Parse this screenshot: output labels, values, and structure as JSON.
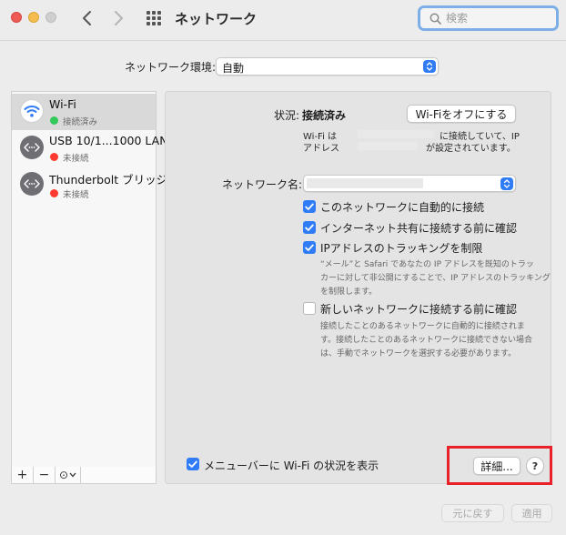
{
  "window": {
    "title": "ネットワーク",
    "search_placeholder": "検索"
  },
  "location": {
    "label": "ネットワーク環境:",
    "value": "自動"
  },
  "sidebar": {
    "services": [
      {
        "name": "Wi-Fi",
        "status": "接続済み",
        "status_color": "#34c759",
        "icon": "wifi-icon",
        "selected": true
      },
      {
        "name": "USB 10/1...1000 LAN",
        "status": "未接続",
        "status_color": "#ff3b30",
        "icon": "ethernet-icon",
        "selected": false
      },
      {
        "name": "Thunderbolt ブリッジ",
        "status": "未接続",
        "status_color": "#ff3b30",
        "icon": "ethernet-icon",
        "selected": false
      }
    ],
    "toolbar": {
      "add": "+",
      "remove": "−",
      "action": "⊙"
    }
  },
  "main": {
    "status_label": "状況:",
    "status_value": "接続済み",
    "wifi_off_button": "Wi-Fiをオフにする",
    "status_line1_prefix": "Wi-Fi は",
    "status_line1_suffix": "に接続していて、IP",
    "status_line2_prefix": "アドレス",
    "status_line2_suffix": "が設定されています。",
    "network_name_label": "ネットワーク名:",
    "network_name_value": "",
    "options": [
      {
        "label": "このネットワークに自動的に接続",
        "checked": true
      },
      {
        "label": "インターネット共有に接続する前に確認",
        "checked": true
      },
      {
        "label": "IPアドレスのトラッキングを制限",
        "checked": true
      }
    ],
    "tracking_note": [
      "“メール”と Safari であなたの IP アドレスを既知のトラッ",
      "カーに対して非公開にすることで、IP アドレスのトラッキング",
      "を制限します。"
    ],
    "ask_new_network": {
      "label": "新しいネットワークに接続する前に確認",
      "checked": false
    },
    "ask_note": [
      "接続したことのあるネットワークに自動的に接続されま",
      "す。接続したことのあるネットワークに接続できない場合",
      "は、手動でネットワークを選択する必要があります。"
    ],
    "show_in_menubar": {
      "label": "メニューバーに Wi-Fi の状況を表示",
      "checked": true
    },
    "advanced_button": "詳細...",
    "help_button": "?"
  },
  "footer": {
    "revert_button": "元に戻す",
    "apply_button": "適用"
  },
  "colors": {
    "accent": "#2f7cf6",
    "highlight": "#e8212b"
  }
}
